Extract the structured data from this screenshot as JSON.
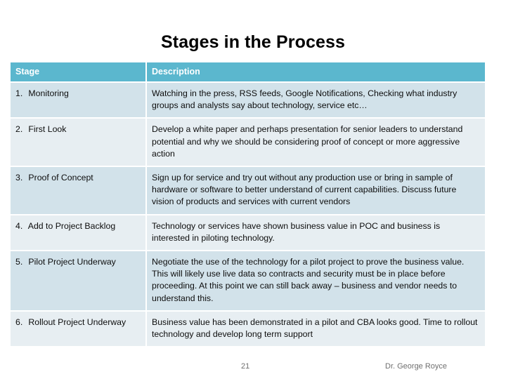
{
  "slide": {
    "title": "Stages in the Process",
    "background_color": "#FFFFFF"
  },
  "table": {
    "header_bg": "#5BB7CE",
    "row_odd_bg": "#D2E2EA",
    "row_even_bg": "#E7EEF2",
    "columns": [
      {
        "key": "stage",
        "label": "Stage"
      },
      {
        "key": "description",
        "label": "Description"
      }
    ],
    "rows": [
      {
        "number": "1.",
        "stage": "Monitoring",
        "description": "Watching in the press, RSS feeds, Google Notifications,  Checking what industry groups and analysts say about technology, service etc…"
      },
      {
        "number": "2.",
        "stage": "First Look",
        "description": "Develop a white paper and perhaps presentation for senior leaders to understand potential and why we should be considering proof of concept or more aggressive action"
      },
      {
        "number": "3.",
        "stage": "Proof of Concept",
        "description": "Sign up for service and try out without any production use or bring in sample of hardware or software to better understand of current capabilities.  Discuss future vision of products and services with current vendors"
      },
      {
        "number": "4.",
        "stage": "Add to Project Backlog",
        "description": "Technology or services have shown business value in POC and business is interested in piloting technology."
      },
      {
        "number": "5.",
        "stage": "Pilot Project Underway",
        "description": "Negotiate the use of the technology for a pilot project to prove the business value.  This will likely use live data so contracts and security must be in place before proceeding.  At this point we can still back away – business and vendor needs to understand this."
      },
      {
        "number": "6.",
        "stage": "Rollout Project Underway",
        "description": "Business value has been demonstrated in a pilot and CBA looks good. Time to rollout technology and develop long term support"
      }
    ]
  },
  "footer": {
    "slide_number": "21",
    "author": "Dr. George Royce"
  }
}
